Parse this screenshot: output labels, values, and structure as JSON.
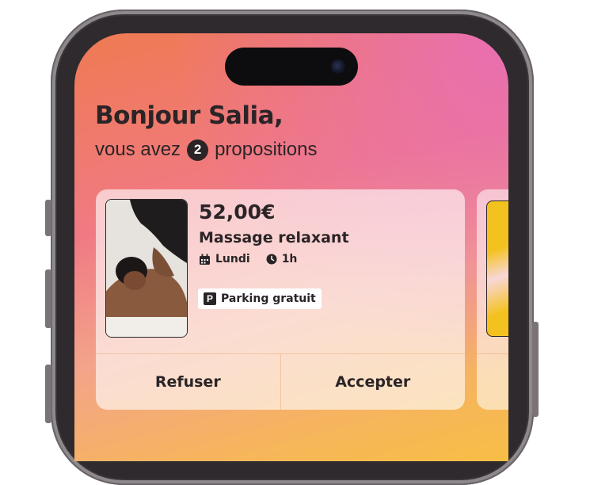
{
  "greeting": "Bonjour Salia,",
  "subtitle": {
    "before": "vous avez",
    "count": "2",
    "after": "propositions"
  },
  "proposal": {
    "price": "52,00€",
    "service": "Massage relaxant",
    "day": "Lundi",
    "duration": "1h",
    "tag": "Parking gratuit",
    "tag_icon": "P"
  },
  "actions": {
    "decline": "Refuser",
    "accept": "Accepter"
  },
  "colors": {
    "text": "#2b2426",
    "accent_yellow": "#f4c21f"
  }
}
